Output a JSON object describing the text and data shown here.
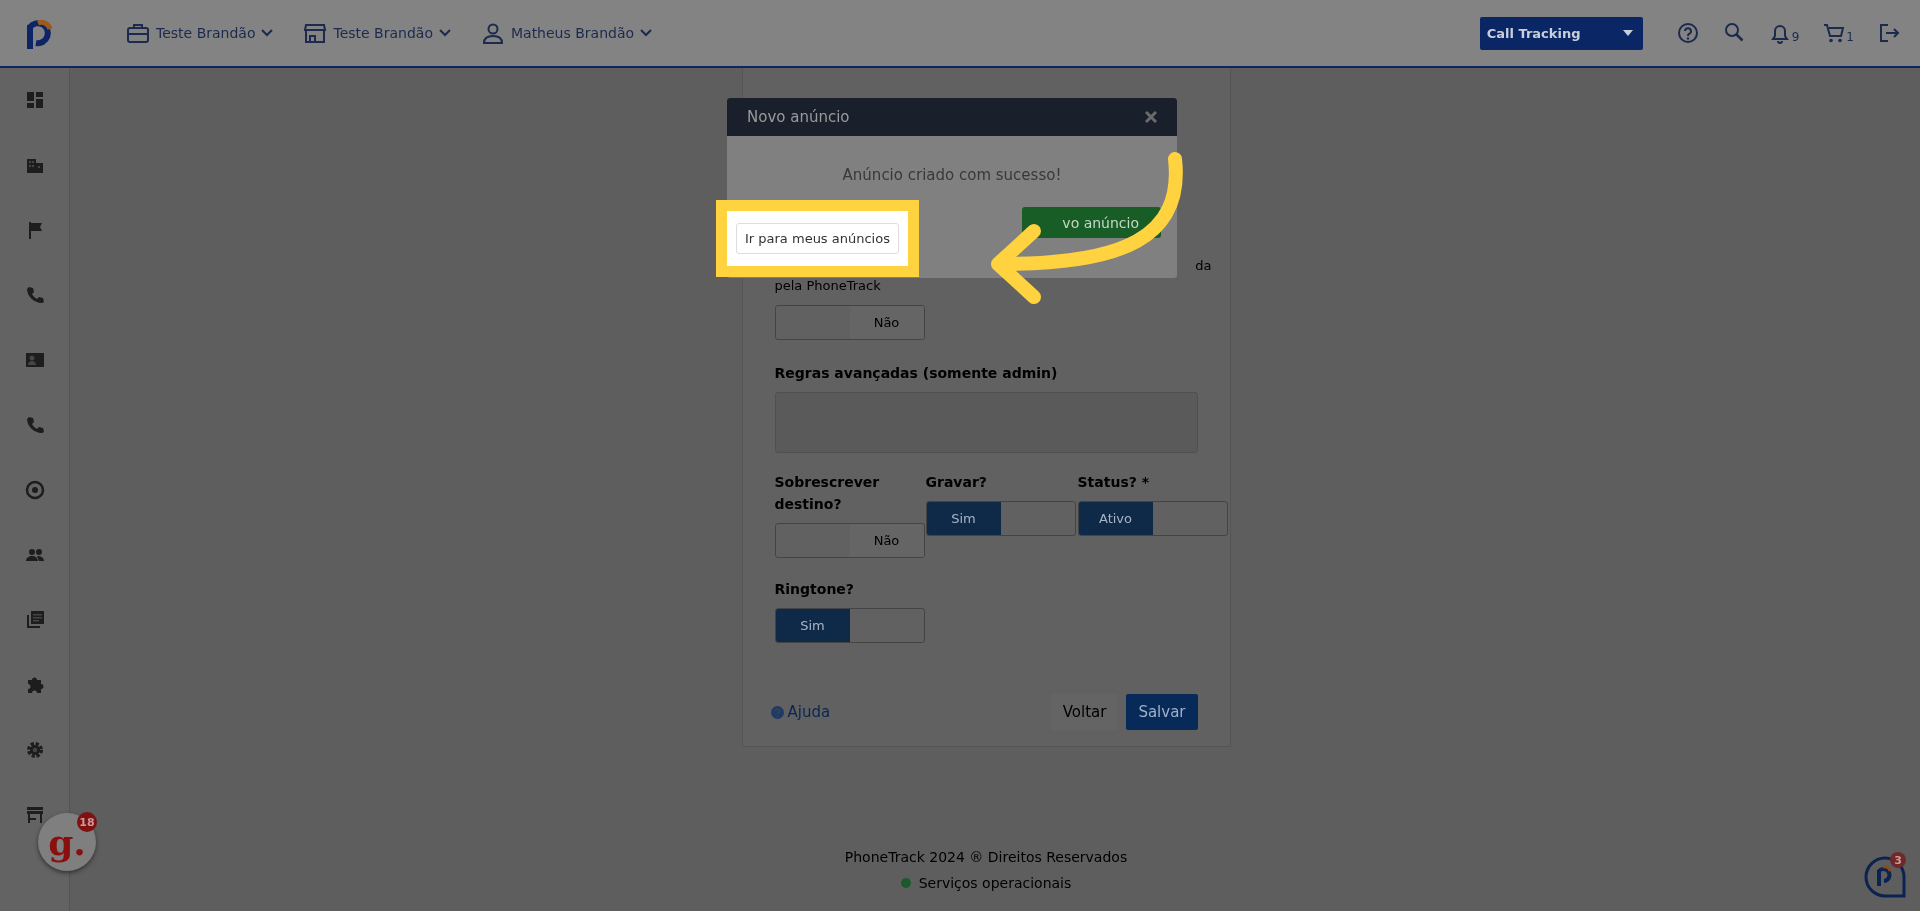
{
  "topbar": {
    "menus": [
      {
        "label": "Teste Brandão"
      },
      {
        "label": "Teste Brandão"
      },
      {
        "label": "Matheus Brandão"
      }
    ],
    "product_select": {
      "value": "Call Tracking"
    },
    "notifications": {
      "count": "9"
    },
    "cart": {
      "count": "1"
    }
  },
  "form": {
    "cut_text": "da",
    "hint": "pela PhoneTrack",
    "first_toggle": {
      "on": false,
      "text": "Não"
    },
    "rules": {
      "label": "Regras avançadas (somente admin)"
    },
    "toggles": [
      {
        "label": "Sobrescrever destino?",
        "on": false,
        "text": "Não"
      },
      {
        "label": "Gravar?",
        "on": true,
        "text": "Sim"
      },
      {
        "label": "Status? *",
        "on": true,
        "text": "Ativo"
      },
      {
        "label": "Ringtone?",
        "on": true,
        "text": "Sim"
      }
    ],
    "help": "Ajuda",
    "buttons": [
      {
        "label": "Voltar",
        "kind": "secondary"
      },
      {
        "label": "Salvar",
        "kind": "primary"
      }
    ]
  },
  "modal": {
    "title": "Novo anúncio",
    "message": "Anúncio criado com sucesso!",
    "buttons": [
      {
        "label": "Ir para meus anúncios",
        "kind": "light",
        "highlighted": true
      },
      {
        "label": "vo anúncio",
        "kind": "success",
        "highlighted": false
      }
    ]
  },
  "footer": {
    "copyright": "PhoneTrack 2024 ® Direitos Reservados",
    "status": {
      "text": "Serviços operacionais",
      "color": "#1c5a2c"
    }
  },
  "chat_widget": {
    "logo": "g.",
    "badge": "18"
  },
  "help_widget": {
    "badge": "3"
  }
}
